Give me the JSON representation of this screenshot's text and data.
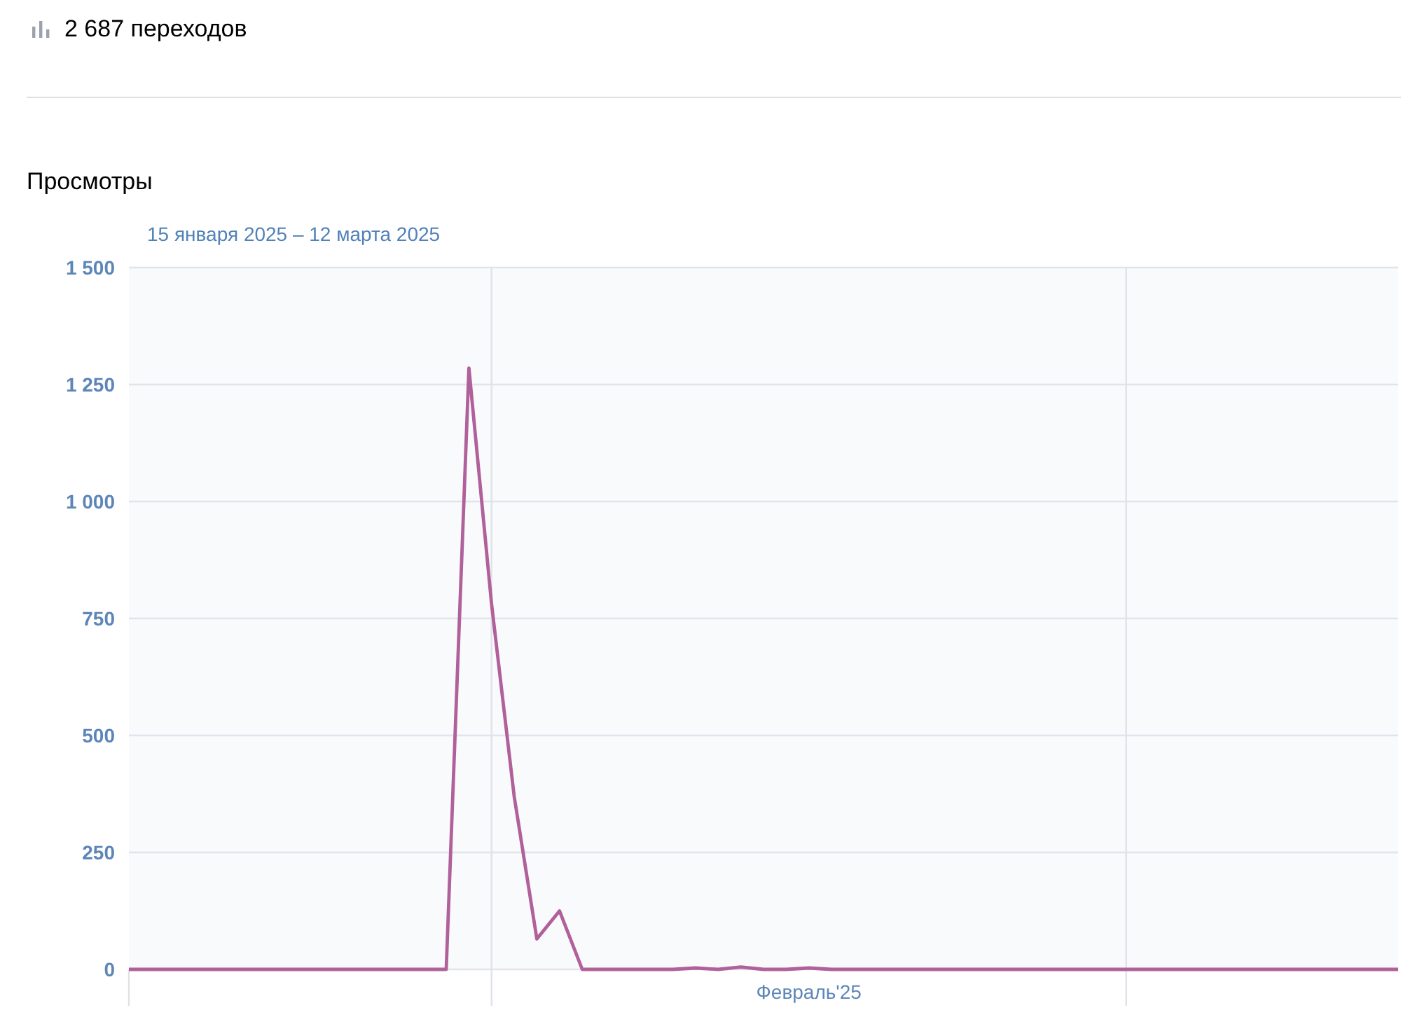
{
  "stats": {
    "clicks": "2 687 переходов"
  },
  "views": {
    "title": "Просмотры",
    "period": "15 января 2025 – 12 марта 2025",
    "chart_data": {
      "type": "line",
      "grid": true,
      "series": [
        {
          "color": "#b0609a",
          "values": [
            0,
            0,
            0,
            0,
            0,
            0,
            0,
            0,
            0,
            0,
            0,
            0,
            0,
            0,
            0,
            1285,
            780,
            370,
            65,
            125,
            0,
            0,
            0,
            0,
            0,
            3,
            0,
            5,
            0,
            0,
            3,
            0,
            0,
            0,
            0,
            0,
            0,
            0,
            0,
            0,
            0,
            0,
            0,
            0,
            0,
            0,
            0,
            0,
            0,
            0,
            0,
            0,
            0,
            0,
            0,
            0,
            0
          ]
        }
      ],
      "ylim": [
        0,
        1500
      ],
      "yticks": [
        {
          "value": 0,
          "label": "0"
        },
        {
          "value": 250,
          "label": "250"
        },
        {
          "value": 500,
          "label": "500"
        },
        {
          "value": 750,
          "label": "750"
        },
        {
          "value": 1000,
          "label": "1 000"
        },
        {
          "value": 1250,
          "label": "1 250"
        },
        {
          "value": 1500,
          "label": "1 500"
        }
      ],
      "xlabel": "Февраль'25"
    }
  }
}
